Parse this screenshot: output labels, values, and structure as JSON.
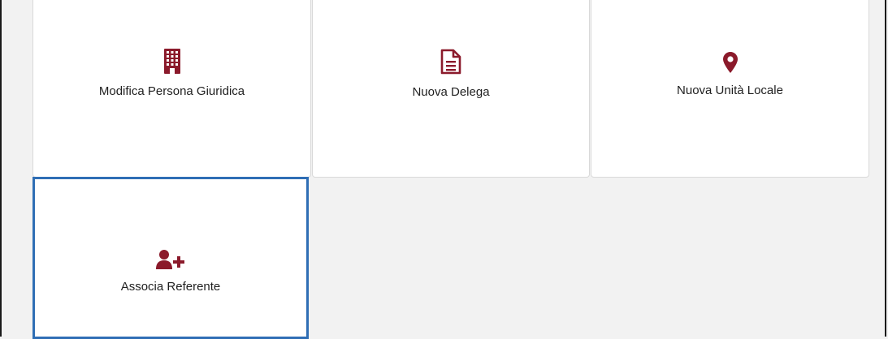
{
  "accent_color": "#8b1a2b",
  "selected_border_color": "#2f6eb5",
  "tiles": [
    {
      "label": "Modifica Persona Giuridica",
      "icon": "building-icon"
    },
    {
      "label": "Nuova Delega",
      "icon": "document-icon"
    },
    {
      "label": "Nuova Unità Locale",
      "icon": "map-marker-icon"
    },
    {
      "label": "Associa Referente",
      "icon": "user-plus-icon"
    }
  ]
}
